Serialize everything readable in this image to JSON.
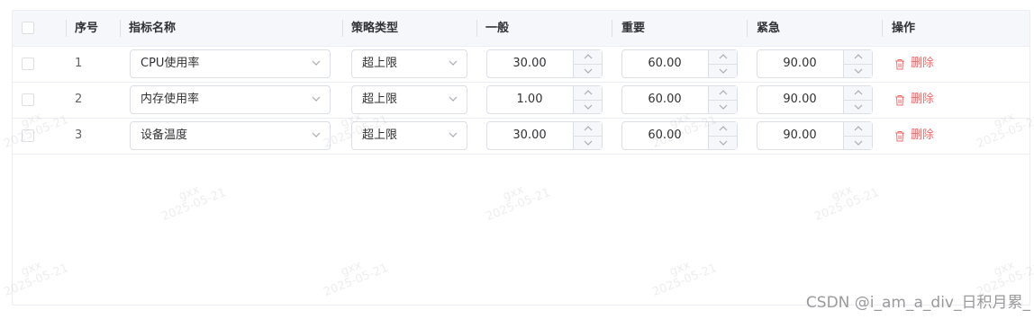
{
  "header": {
    "columns": [
      "序号",
      "指标名称",
      "策略类型",
      "一般",
      "重要",
      "紧急",
      "操作"
    ]
  },
  "rows": [
    {
      "index": "1",
      "metric": "CPU使用率",
      "strategy": "超上限",
      "normal": "30.00",
      "important": "60.00",
      "urgent": "90.00",
      "action": "删除"
    },
    {
      "index": "2",
      "metric": "内存使用率",
      "strategy": "超上限",
      "normal": "1.00",
      "important": "60.00",
      "urgent": "90.00",
      "action": "删除"
    },
    {
      "index": "3",
      "metric": "设备温度",
      "strategy": "超上限",
      "normal": "30.00",
      "important": "60.00",
      "urgent": "90.00",
      "action": "删除"
    }
  ],
  "watermark": {
    "name": "gxx",
    "date": "2025-05-21"
  },
  "footer": "CSDN @i_am_a_div_日积月累_",
  "colors": {
    "danger": "#f56c6c",
    "header_bg": "#f5f7fa",
    "border": "#dcdfe6"
  }
}
